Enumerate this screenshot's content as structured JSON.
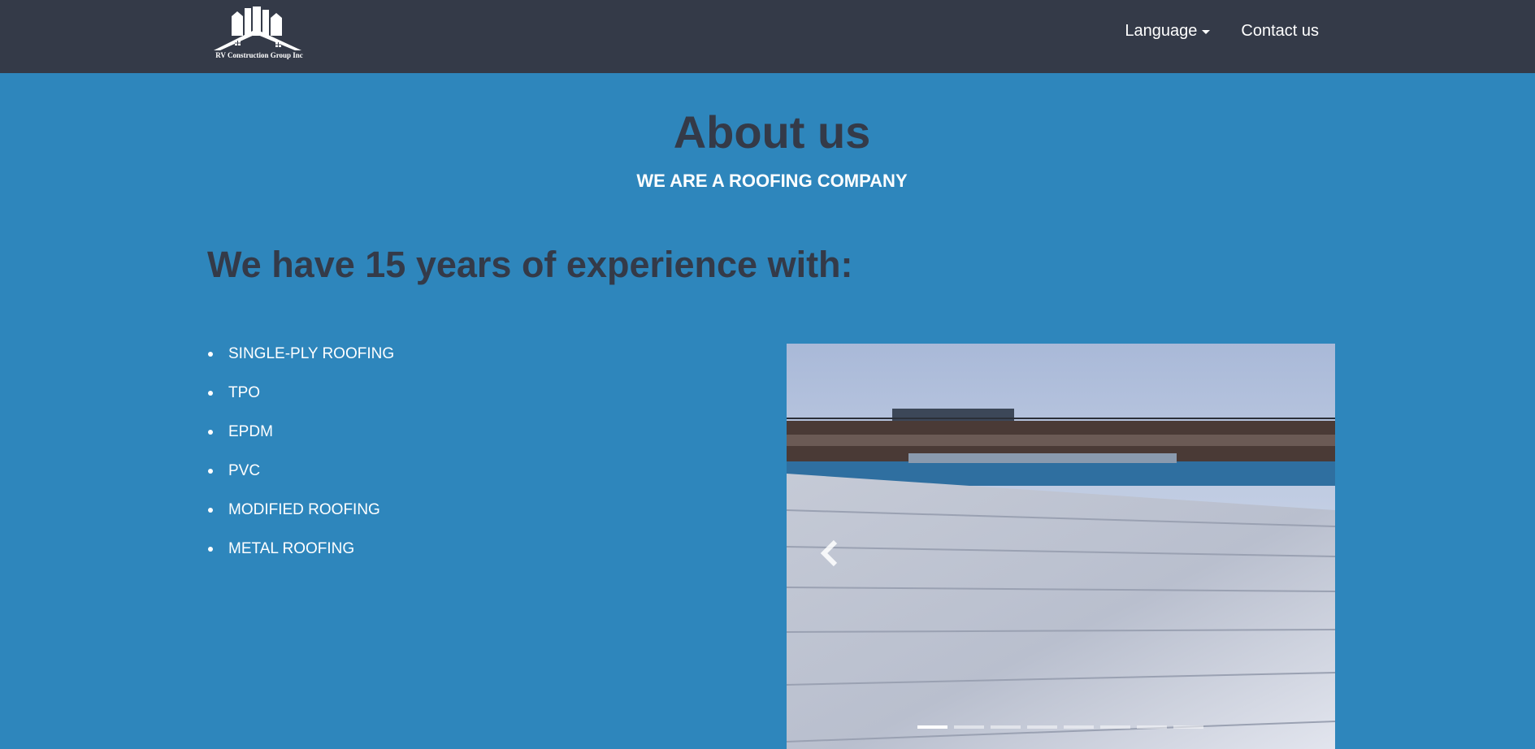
{
  "nav": {
    "logo_text": "RV Construction Group Inc",
    "language_label": "Language",
    "contact_label": "Contact us"
  },
  "about": {
    "title": "About us",
    "subtitle": "WE ARE A ROOFING COMPANY",
    "experience_heading": "We have 15 years of experience with:"
  },
  "services": [
    "SINGLE-PLY ROOFING",
    "TPO",
    "EPDM",
    "PVC",
    "MODIFIED ROOFING",
    "METAL ROOFING"
  ],
  "carousel": {
    "slide_count": 8,
    "active_index": 0
  },
  "colors": {
    "navbar": "#343a48",
    "page_background": "#2e86bc",
    "heading": "#343a48",
    "text": "#ffffff"
  },
  "icons": {
    "logo": "buildings-house-logo",
    "language_caret": "caret-down-icon",
    "carousel_prev": "chevron-left-icon"
  }
}
